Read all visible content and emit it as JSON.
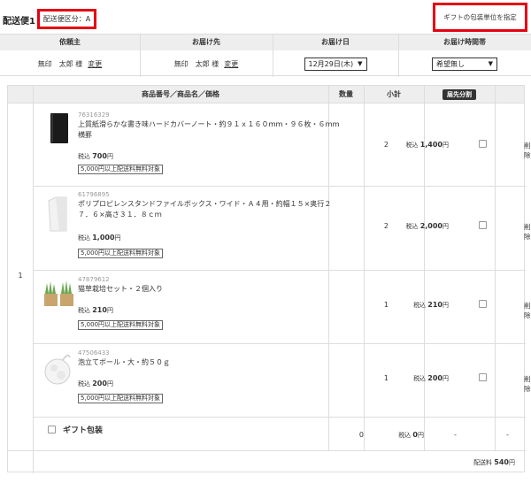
{
  "header": {
    "title": "配送便1",
    "delivery_class": "配送便区分：A",
    "gift_button": "ギフトの包装単位を指定"
  },
  "info": {
    "columns": [
      "依頼主",
      "お届け先",
      "お届け日",
      "お届け時間帯"
    ],
    "sender_name": "無印　太郎 様",
    "sender_change": "変更",
    "recipient_name": "無印　太郎 様",
    "recipient_change": "変更",
    "date_value": "12月29日(木)",
    "time_value": "希望無し"
  },
  "table": {
    "headers": {
      "product": "商品番号／商品名／価格",
      "qty": "数量",
      "subtotal": "小計",
      "split": "届先分割"
    },
    "group_no": "1",
    "items": [
      {
        "code": "76316329",
        "name": "上質紙滑らかな書き味ハードカバーノート・約９１ｘ１６０ｍｍ・９６枚・６ｍｍ横罫",
        "price_prefix": "税込",
        "price": "700",
        "price_unit": "円",
        "note": "5,000円以上配送料無料対象",
        "qty": "2",
        "subtotal_prefix": "税込",
        "subtotal": "1,400",
        "subtotal_unit": "円",
        "delete": "削除"
      },
      {
        "code": "61796895",
        "name": "ポリプロピレンスタンドファイルボックス・ワイド・Ａ４用・約幅１５×奥行２７．６×高さ３１．８ｃｍ",
        "price_prefix": "税込",
        "price": "1,000",
        "price_unit": "円",
        "note": "5,000円以上配送料無料対象",
        "qty": "2",
        "subtotal_prefix": "税込",
        "subtotal": "2,000",
        "subtotal_unit": "円",
        "delete": "削除"
      },
      {
        "code": "47879612",
        "name": "猫草栽培セット・２個入り",
        "price_prefix": "税込",
        "price": "210",
        "price_unit": "円",
        "note": "5,000円以上配送料無料対象",
        "qty": "1",
        "subtotal_prefix": "税込",
        "subtotal": "210",
        "subtotal_unit": "円",
        "delete": "削除"
      },
      {
        "code": "47506433",
        "name": "泡立てボール・大・約５０ｇ",
        "price_prefix": "税込",
        "price": "200",
        "price_unit": "円",
        "note": "5,000円以上配送料無料対象",
        "qty": "1",
        "subtotal_prefix": "税込",
        "subtotal": "200",
        "subtotal_unit": "円",
        "delete": "削除"
      }
    ],
    "gift": {
      "label": "ギフト包装",
      "qty": "0",
      "subtotal_prefix": "税込",
      "subtotal": "0",
      "subtotal_unit": "円",
      "split": "-",
      "delete": "-"
    },
    "shipping": {
      "label": "配送料",
      "value": "540",
      "unit": "円"
    }
  },
  "icons": [
    "notebook-thumbnail",
    "file-box-thumbnail",
    "cat-grass-thumbnail",
    "foam-ball-thumbnail",
    "caret-down-icon"
  ],
  "colors": {
    "highlight": "#e50012",
    "header_bg": "#eeeeee"
  }
}
